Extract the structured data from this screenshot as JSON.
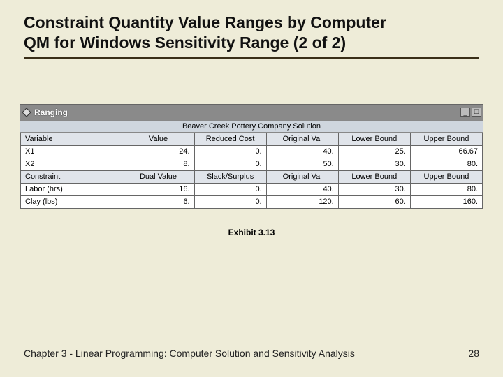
{
  "slide": {
    "title_line1": "Constraint Quantity Value Ranges by Computer",
    "title_line2": "QM for Windows Sensitivity Range (2 of 2)",
    "exhibit_label": "Exhibit 3.13",
    "footer_text": "Chapter 3 - Linear Programming:  Computer Solution and Sensitivity Analysis",
    "page_number": "28"
  },
  "window": {
    "icon": "diamond-icon",
    "title": "Ranging",
    "subtitle": "Beaver Creek Pottery Company Solution",
    "min_label": "_",
    "close_label": "☐",
    "variable_header": {
      "c0": "Variable",
      "c1": "Value",
      "c2": "Reduced Cost",
      "c3": "Original Val",
      "c4": "Lower Bound",
      "c5": "Upper Bound"
    },
    "variable_rows": [
      {
        "name": "X1",
        "value": "24.",
        "reduced": "0.",
        "orig": "40.",
        "lower": "25.",
        "upper": "66.67"
      },
      {
        "name": "X2",
        "value": "8.",
        "reduced": "0.",
        "orig": "50.",
        "lower": "30.",
        "upper": "80."
      }
    ],
    "constraint_header": {
      "c0": "Constraint",
      "c1": "Dual Value",
      "c2": "Slack/Surplus",
      "c3": "Original Val",
      "c4": "Lower Bound",
      "c5": "Upper Bound"
    },
    "constraint_rows": [
      {
        "name": "Labor (hrs)",
        "dual": "16.",
        "slack": "0.",
        "orig": "40.",
        "lower": "30.",
        "upper": "80."
      },
      {
        "name": "Clay (lbs)",
        "dual": "6.",
        "slack": "0.",
        "orig": "120.",
        "lower": "60.",
        "upper": "160."
      }
    ]
  }
}
